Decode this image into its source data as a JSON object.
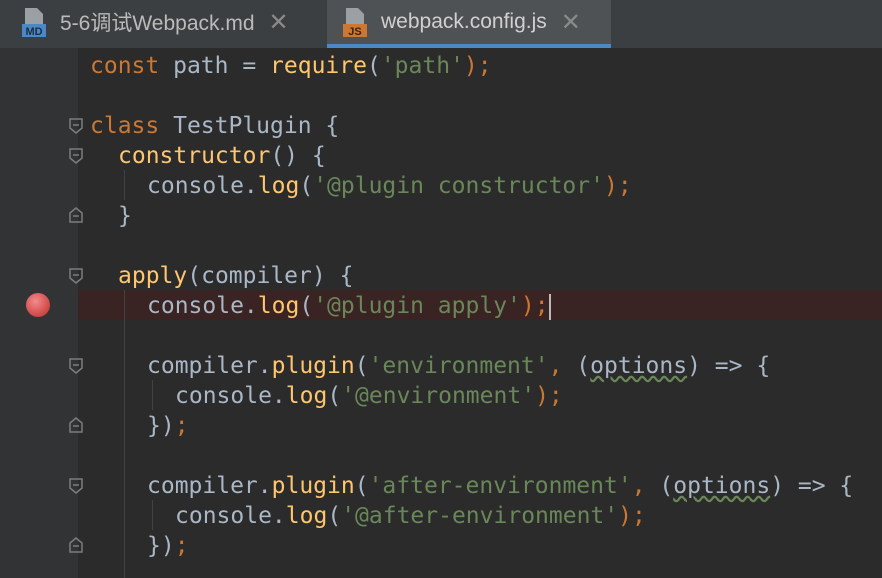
{
  "tabs": [
    {
      "label": "5-6调试Webpack.md",
      "badge": "MD",
      "badge_color": "#4a88c7",
      "active": false
    },
    {
      "label": "webpack.config.js",
      "badge": "JS",
      "badge_color": "#cc7832",
      "active": true
    }
  ],
  "code": {
    "l1": {
      "t1": "const",
      "t2": " path = ",
      "t3": "require",
      "t4": "(",
      "t5": "'path'",
      "t6": ");"
    },
    "l3": {
      "t1": "class",
      "t2": " TestPlugin {"
    },
    "l4": {
      "t1": "constructor",
      "t2": "() {"
    },
    "l5": {
      "t1": "console.",
      "t2": "log",
      "t3": "(",
      "t4": "'@plugin constructor'",
      "t5": ");"
    },
    "l6": {
      "t1": "}"
    },
    "l8": {
      "t1": "apply",
      "t2": "(compiler) {"
    },
    "l9": {
      "t1": "console.",
      "t2": "log",
      "t3": "(",
      "t4": "'@plugin apply'",
      "t5": ");"
    },
    "l11": {
      "t1": "compiler.",
      "t2": "plugin",
      "t3": "(",
      "t4": "'environment'",
      "t5": ", ",
      "t6": "(",
      "t7": "options",
      "t8": ") => {"
    },
    "l12": {
      "t1": "console.",
      "t2": "log",
      "t3": "(",
      "t4": "'@environment'",
      "t5": ");"
    },
    "l13": {
      "t1": "})",
      "t2": ";"
    },
    "l15": {
      "t1": "compiler.",
      "t2": "plugin",
      "t3": "(",
      "t4": "'after-environment'",
      "t5": ", ",
      "t6": "(",
      "t7": "options",
      "t8": ") => {"
    },
    "l16": {
      "t1": "console.",
      "t2": "log",
      "t3": "(",
      "t4": "'@after-environment'",
      "t5": ");"
    },
    "l17": {
      "t1": "})",
      "t2": ";"
    }
  }
}
